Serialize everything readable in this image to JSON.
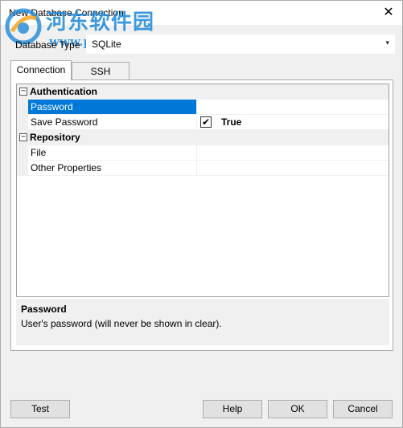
{
  "window": {
    "title": "New Database Connection",
    "close_glyph": "✕"
  },
  "watermark": {
    "line1": "河东软件园",
    "line2": "www.pc0359.cn"
  },
  "database_type": {
    "label": "Database Type",
    "value": "SQLite",
    "arrow_glyph": "▾"
  },
  "tabs": [
    {
      "label": "Connection",
      "selected": true
    },
    {
      "label": "SSH",
      "selected": false
    }
  ],
  "property_grid": {
    "categories": [
      {
        "label": "Authentication",
        "toggle": "−",
        "properties": [
          {
            "name": "Password",
            "value": "",
            "selected": true
          },
          {
            "name": "Save Password",
            "value": "True",
            "checked": true
          }
        ]
      },
      {
        "label": "Repository",
        "toggle": "−",
        "properties": [
          {
            "name": "File",
            "value": ""
          },
          {
            "name": "Other Properties",
            "value": ""
          }
        ]
      }
    ],
    "check_glyph": "✔"
  },
  "description": {
    "title": "Password",
    "text": "User's password (will never be shown in clear)."
  },
  "buttons": {
    "test": "Test",
    "help": "Help",
    "ok": "OK",
    "cancel": "Cancel"
  },
  "colors": {
    "selection": "#0078d7",
    "watermark": "#1e88d8"
  }
}
